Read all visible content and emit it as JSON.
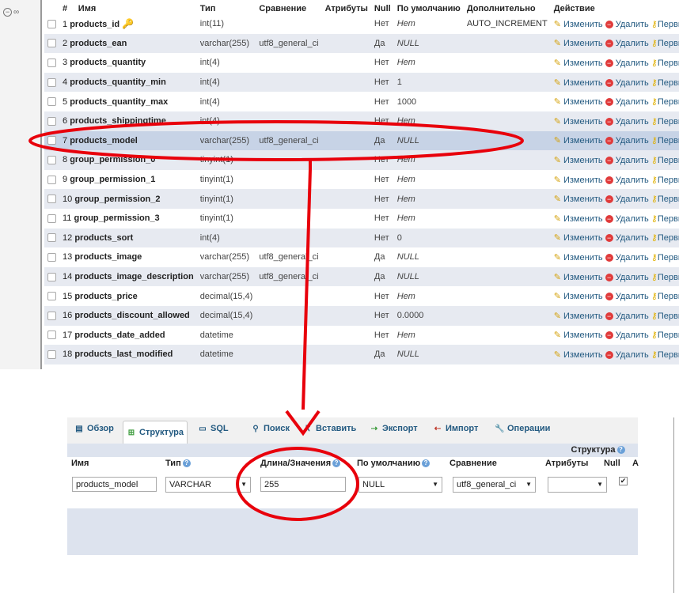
{
  "columns": [
    "#",
    "Имя",
    "Тип",
    "Сравнение",
    "Атрибуты",
    "Null",
    "По умолчанию",
    "Дополнительно",
    "Действие"
  ],
  "actions": {
    "edit": "Изменить",
    "delete": "Удалить",
    "primary": "Первичный"
  },
  "rows": [
    {
      "num": "1",
      "name": "products_id",
      "type": "int(11)",
      "coll": "",
      "nul": "Нет",
      "def": "Нет",
      "extra": "AUTO_INCREMENT"
    },
    {
      "num": "2",
      "name": "products_ean",
      "type": "varchar(255)",
      "coll": "utf8_general_ci",
      "nul": "Да",
      "def": "NULL",
      "extra": ""
    },
    {
      "num": "3",
      "name": "products_quantity",
      "type": "int(4)",
      "coll": "",
      "nul": "Нет",
      "def": "Нет",
      "extra": ""
    },
    {
      "num": "4",
      "name": "products_quantity_min",
      "type": "int(4)",
      "coll": "",
      "nul": "Нет",
      "def": "1",
      "extra": ""
    },
    {
      "num": "5",
      "name": "products_quantity_max",
      "type": "int(4)",
      "coll": "",
      "nul": "Нет",
      "def": "1000",
      "extra": ""
    },
    {
      "num": "6",
      "name": "products_shippingtime",
      "type": "int(4)",
      "coll": "",
      "nul": "Нет",
      "def": "Нет",
      "extra": ""
    },
    {
      "num": "7",
      "name": "products_model",
      "type": "varchar(255)",
      "coll": "utf8_general_ci",
      "nul": "Да",
      "def": "NULL",
      "extra": ""
    },
    {
      "num": "8",
      "name": "group_permission_0",
      "type": "tinyint(1)",
      "coll": "",
      "nul": "Нет",
      "def": "Нет",
      "extra": ""
    },
    {
      "num": "9",
      "name": "group_permission_1",
      "type": "tinyint(1)",
      "coll": "",
      "nul": "Нет",
      "def": "Нет",
      "extra": ""
    },
    {
      "num": "10",
      "name": "group_permission_2",
      "type": "tinyint(1)",
      "coll": "",
      "nul": "Нет",
      "def": "Нет",
      "extra": ""
    },
    {
      "num": "11",
      "name": "group_permission_3",
      "type": "tinyint(1)",
      "coll": "",
      "nul": "Нет",
      "def": "Нет",
      "extra": ""
    },
    {
      "num": "12",
      "name": "products_sort",
      "type": "int(4)",
      "coll": "",
      "nul": "Нет",
      "def": "0",
      "extra": ""
    },
    {
      "num": "13",
      "name": "products_image",
      "type": "varchar(255)",
      "coll": "utf8_general_ci",
      "nul": "Да",
      "def": "NULL",
      "extra": ""
    },
    {
      "num": "14",
      "name": "products_image_description",
      "type": "varchar(255)",
      "coll": "utf8_general_ci",
      "nul": "Да",
      "def": "NULL",
      "extra": ""
    },
    {
      "num": "15",
      "name": "products_price",
      "type": "decimal(15,4)",
      "coll": "",
      "nul": "Нет",
      "def": "Нет",
      "extra": ""
    },
    {
      "num": "16",
      "name": "products_discount_allowed",
      "type": "decimal(15,4)",
      "coll": "",
      "nul": "Нет",
      "def": "0.0000",
      "extra": ""
    },
    {
      "num": "17",
      "name": "products_date_added",
      "type": "datetime",
      "coll": "",
      "nul": "Нет",
      "def": "Нет",
      "extra": ""
    },
    {
      "num": "18",
      "name": "products_last_modified",
      "type": "datetime",
      "coll": "",
      "nul": "Да",
      "def": "NULL",
      "extra": ""
    }
  ],
  "tabs": [
    "Обзор",
    "Структура",
    "SQL",
    "Поиск",
    "Вставить",
    "Экспорт",
    "Импорт",
    "Операции"
  ],
  "edit_form": {
    "caption": "Структура",
    "headers": {
      "name": "Имя",
      "type": "Тип",
      "length": "Длина/Значения",
      "default": "По умолчанию",
      "collation": "Сравнение",
      "attributes": "Атрибуты",
      "null": "Null",
      "a_index": "A"
    },
    "name_value": "products_model",
    "type_value": "VARCHAR",
    "length_value": "255",
    "default_value": "NULL",
    "collation_value": "utf8_general_ci",
    "attributes_value": "",
    "null_checked": true
  },
  "colors": {
    "row_alt": "#e7eaf1",
    "row_marked": "#c7d3e6",
    "link": "#235a81",
    "annotation": "#e8000b"
  }
}
